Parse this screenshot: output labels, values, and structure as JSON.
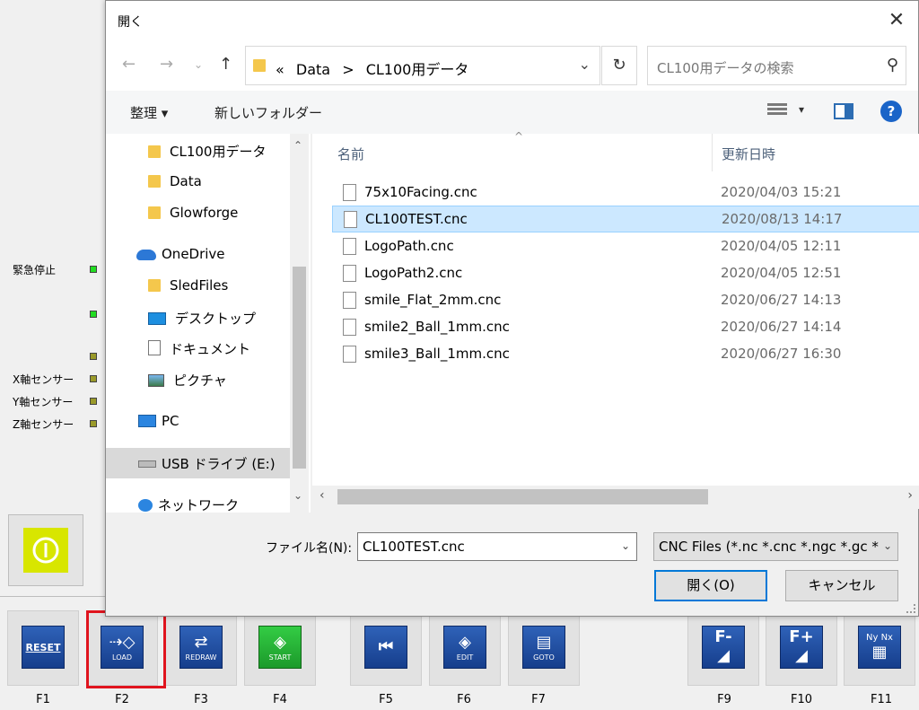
{
  "background_app": {
    "sensors": [
      {
        "label": "緊急停止",
        "led": "green"
      },
      {
        "label": "",
        "led": "green"
      },
      {
        "label": "",
        "led": "olive"
      },
      {
        "label": "X軸センサー",
        "led": "olive"
      },
      {
        "label": "Y軸センサー",
        "led": "olive"
      },
      {
        "label": "Z軸センサー",
        "led": "olive"
      }
    ],
    "function_keys": [
      {
        "key": "F1",
        "icon_text": "RESET",
        "icon": "reset-icon"
      },
      {
        "key": "F2",
        "icon_text": "LOAD",
        "icon": "load-icon"
      },
      {
        "key": "F3",
        "icon_text": "REDRAW",
        "icon": "redraw-icon"
      },
      {
        "key": "F4",
        "icon_text": "START",
        "icon": "start-icon"
      },
      {
        "key": "F5",
        "icon_text": "",
        "icon": "rewind-icon"
      },
      {
        "key": "F6",
        "icon_text": "EDIT",
        "icon": "edit-icon"
      },
      {
        "key": "F7",
        "icon_text": "GOTO",
        "icon": "goto-icon"
      },
      {
        "key": "F9",
        "icon_text": "F-",
        "icon": "feed-minus-icon"
      },
      {
        "key": "F10",
        "icon_text": "F+",
        "icon": "feed-plus-icon"
      },
      {
        "key": "F11",
        "icon_text": "Ny Nx",
        "icon": "grid-icon"
      }
    ],
    "highlight_color": "#e0141e"
  },
  "dialog": {
    "title": "開く",
    "address": {
      "prefix": "«",
      "crumbs": [
        "Data",
        ">",
        "CL100用データ"
      ]
    },
    "search_placeholder": "CL100用データの検索",
    "toolbar": {
      "organize": "整理 ▾",
      "new_folder": "新しいフォルダー"
    },
    "sidebar": {
      "items": [
        {
          "label": "CL100用データ",
          "icon": "folder-icon"
        },
        {
          "label": "Data",
          "icon": "folder-icon"
        },
        {
          "label": "Glowforge",
          "icon": "folder-icon"
        },
        {
          "label": "OneDrive",
          "icon": "cloud-icon"
        },
        {
          "label": "SledFiles",
          "icon": "folder-icon"
        },
        {
          "label": "デスクトップ",
          "icon": "desktop-icon"
        },
        {
          "label": "ドキュメント",
          "icon": "document-icon"
        },
        {
          "label": "ピクチャ",
          "icon": "picture-icon"
        },
        {
          "label": "PC",
          "icon": "pc-icon"
        },
        {
          "label": "USB ドライブ (E:)",
          "icon": "usb-drive-icon"
        },
        {
          "label": "ネットワーク",
          "icon": "network-icon"
        }
      ]
    },
    "columns": {
      "name": "名前",
      "date": "更新日時"
    },
    "files": [
      {
        "name": "75x10Facing.cnc",
        "date": "2020/04/03 15:21",
        "selected": false
      },
      {
        "name": "CL100TEST.cnc",
        "date": "2020/08/13 14:17",
        "selected": true
      },
      {
        "name": "LogoPath.cnc",
        "date": "2020/04/05 12:11",
        "selected": false
      },
      {
        "name": "LogoPath2.cnc",
        "date": "2020/04/05 12:51",
        "selected": false
      },
      {
        "name": "smile_Flat_2mm.cnc",
        "date": "2020/06/27 14:13",
        "selected": false
      },
      {
        "name": "smile2_Ball_1mm.cnc",
        "date": "2020/06/27 14:14",
        "selected": false
      },
      {
        "name": "smile3_Ball_1mm.cnc",
        "date": "2020/06/27 16:30",
        "selected": false
      }
    ],
    "filename_label": "ファイル名(N):",
    "filename_value": "CL100TEST.cnc",
    "filetype": "CNC Files (*.nc *.cnc *.ngc *.gc *",
    "open_button": "開く(O)",
    "cancel_button": "キャンセル",
    "colors": {
      "selection": "#cce8ff",
      "accent": "#0078d7"
    }
  }
}
